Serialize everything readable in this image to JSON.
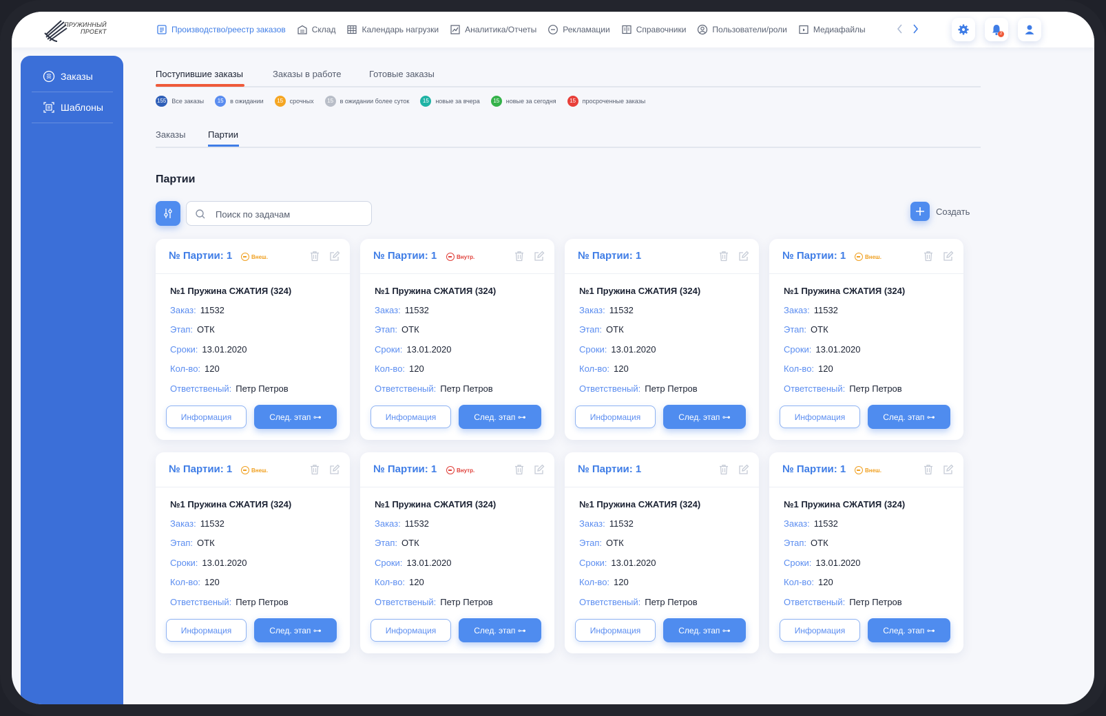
{
  "logo": {
    "line1": "ПРУЖИННЫЙ",
    "line2": "ПРОЕКТ"
  },
  "nav": [
    {
      "label": "Производство/реестр заказов",
      "icon": "registry-icon",
      "active": true
    },
    {
      "label": "Склад",
      "icon": "warehouse-icon"
    },
    {
      "label": "Календарь нагрузки",
      "icon": "calendar-icon"
    },
    {
      "label": "Аналитика/Отчеты",
      "icon": "analytics-icon"
    },
    {
      "label": "Рекламации",
      "icon": "minus-circle-icon"
    },
    {
      "label": "Справочники",
      "icon": "book-icon"
    },
    {
      "label": "Пользователи/роли",
      "icon": "user-circle-icon"
    },
    {
      "label": "Медиафайлы",
      "icon": "media-icon"
    }
  ],
  "notifications": {
    "count": "2"
  },
  "sidebar": [
    {
      "label": "Заказы",
      "icon": "orders-icon"
    },
    {
      "label": "Шаблоны",
      "icon": "templates-icon"
    }
  ],
  "tabs": [
    "Поступившие заказы",
    "Заказы в работе",
    "Готовые заказы"
  ],
  "stats": [
    {
      "count": "155",
      "label": "Все заказы",
      "color": "#2f5fb8"
    },
    {
      "count": "15",
      "label": "в ожидании",
      "color": "#5b8df0"
    },
    {
      "count": "15",
      "label": "срочных",
      "color": "#f5a623"
    },
    {
      "count": "15",
      "label": "в ожидании более суток",
      "color": "#b9bec8"
    },
    {
      "count": "15",
      "label": "новые за вчера",
      "color": "#1fb3a5"
    },
    {
      "count": "15",
      "label": "новые за сегодня",
      "color": "#35b24a"
    },
    {
      "count": "15",
      "label": "просроченные заказы",
      "color": "#e8403a"
    }
  ],
  "subtabs": [
    "Заказы",
    "Партии"
  ],
  "section_title": "Партии",
  "search": {
    "placeholder": "Поиск по задачам"
  },
  "create_label": "Создать",
  "card_labels": {
    "order": "Заказ:",
    "stage": "Этап:",
    "deadline": "Сроки:",
    "qty": "Кол-во:",
    "responsible": "Ответственый:",
    "info_button": "Информация",
    "next_button": "След. этап ⊶"
  },
  "cards": [
    {
      "title": "№ Партии: 1",
      "tag": "Внеш.",
      "tag_type": "ext",
      "name": "№1 Пружина СЖАТИЯ (324)",
      "order": "11532",
      "stage": "ОТК",
      "deadline": "13.01.2020",
      "qty": "120",
      "responsible": "Петр Петров"
    },
    {
      "title": "№ Партии: 1",
      "tag": "Внутр.",
      "tag_type": "int",
      "name": "№1 Пружина СЖАТИЯ (324)",
      "order": "11532",
      "stage": "ОТК",
      "deadline": "13.01.2020",
      "qty": "120",
      "responsible": "Петр Петров"
    },
    {
      "title": "№ Партии: 1",
      "tag": "",
      "tag_type": "none",
      "name": "№1 Пружина СЖАТИЯ (324)",
      "order": "11532",
      "stage": "ОТК",
      "deadline": "13.01.2020",
      "qty": "120",
      "responsible": "Петр Петров"
    },
    {
      "title": "№ Партии: 1",
      "tag": "Внеш.",
      "tag_type": "ext",
      "name": "№1 Пружина СЖАТИЯ (324)",
      "order": "11532",
      "stage": "ОТК",
      "deadline": "13.01.2020",
      "qty": "120",
      "responsible": "Петр Петров"
    },
    {
      "title": "№ Партии: 1",
      "tag": "Внеш.",
      "tag_type": "ext",
      "name": "№1 Пружина СЖАТИЯ (324)",
      "order": "11532",
      "stage": "ОТК",
      "deadline": "13.01.2020",
      "qty": "120",
      "responsible": "Петр Петров"
    },
    {
      "title": "№ Партии: 1",
      "tag": "Внутр.",
      "tag_type": "int",
      "name": "№1 Пружина СЖАТИЯ (324)",
      "order": "11532",
      "stage": "ОТК",
      "deadline": "13.01.2020",
      "qty": "120",
      "responsible": "Петр Петров"
    },
    {
      "title": "№ Партии: 1",
      "tag": "",
      "tag_type": "none",
      "name": "№1 Пружина СЖАТИЯ (324)",
      "order": "11532",
      "stage": "ОТК",
      "deadline": "13.01.2020",
      "qty": "120",
      "responsible": "Петр Петров"
    },
    {
      "title": "№ Партии: 1",
      "tag": "Внеш.",
      "tag_type": "ext",
      "name": "№1 Пружина СЖАТИЯ (324)",
      "order": "11532",
      "stage": "ОТК",
      "deadline": "13.01.2020",
      "qty": "120",
      "responsible": "Петр Петров"
    }
  ]
}
